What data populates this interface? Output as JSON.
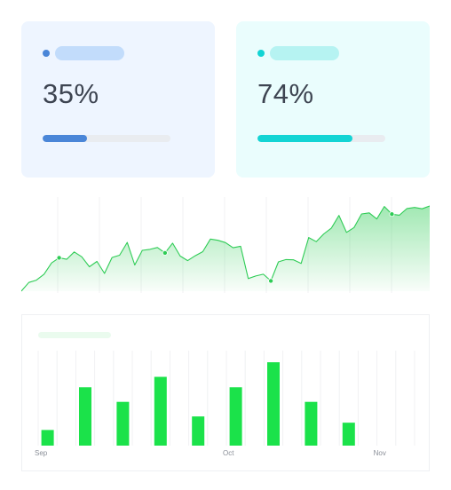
{
  "cards": [
    {
      "value": "35%",
      "progress": 0.35,
      "accent": "#4a86d8",
      "pill": "#c2dcfb"
    },
    {
      "value": "74%",
      "progress": 0.74,
      "accent": "#13d4d4",
      "pill": "#b6f3f2"
    }
  ],
  "colors": {
    "line": "#2ecc55",
    "bar": "#1be24a"
  },
  "chart_data": [
    {
      "type": "area",
      "series": [
        {
          "values": [
            0,
            3.4,
            4.3,
            6.6,
            11,
            13,
            12.4,
            15.3,
            13.4,
            9.5,
            11.6,
            6.9,
            13.1,
            14,
            19,
            10.2,
            15.9,
            16.3,
            17,
            14.9,
            18.7,
            13.7,
            11.9,
            13.8,
            15.4,
            20.3,
            19.8,
            18.9,
            16.9,
            17.5,
            4.9,
            5.9,
            6.6,
            4,
            11.4,
            12.3,
            12.2,
            10.8,
            20.9,
            19.3,
            22.3,
            24.6,
            29.5,
            22.9,
            24.8,
            30.1,
            30.5,
            28.1,
            33,
            30,
            29.6,
            32.2,
            32.6,
            32.1,
            33.2
          ]
        }
      ],
      "highlighted_indices": [
        5,
        19,
        33,
        49
      ]
    },
    {
      "type": "bar",
      "categories": [
        "Sep",
        "",
        "",
        "",
        "",
        "Oct",
        "",
        "",
        "",
        "Nov"
      ],
      "tick_labels": [
        "Sep",
        "Oct",
        "Nov"
      ],
      "values": [
        15,
        56,
        42,
        66,
        28,
        56,
        80,
        42,
        22
      ],
      "ylim": [
        0,
        92
      ]
    }
  ]
}
